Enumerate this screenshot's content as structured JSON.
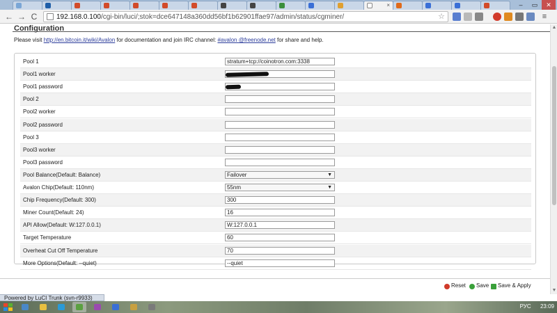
{
  "browser": {
    "tabs": [
      {
        "favicon_color": "#7aa6d6",
        "active": false
      },
      {
        "favicon_color": "#1e5ea8",
        "active": false
      },
      {
        "favicon_color": "#d24b2a",
        "active": false
      },
      {
        "favicon_color": "#d24b2a",
        "active": false
      },
      {
        "favicon_color": "#d24b2a",
        "active": false
      },
      {
        "favicon_color": "#d24b2a",
        "active": false
      },
      {
        "favicon_color": "#d24b2a",
        "active": false
      },
      {
        "favicon_color": "#444444",
        "active": false
      },
      {
        "favicon_color": "#444444",
        "active": false
      },
      {
        "favicon_color": "#3b8f3b",
        "active": false
      },
      {
        "favicon_color": "#3a6fd6",
        "active": false
      },
      {
        "favicon_color": "#e0a030",
        "active": false
      },
      {
        "favicon_color": "#ffffff",
        "active": true
      },
      {
        "favicon_color": "#e06a1a",
        "active": false
      },
      {
        "favicon_color": "#3a6fd6",
        "active": false
      },
      {
        "favicon_color": "#3a6fd6",
        "active": false
      },
      {
        "favicon_color": "#d24b2a",
        "active": false
      }
    ],
    "tab_close_glyph": "×",
    "back_glyph": "←",
    "forward_glyph": "→",
    "reload_glyph": "C",
    "url_host": "192.168.0.100",
    "url_path": "/cgi-bin/luci/;stok=dce647148a360dd56bf1b62901ffae97/admin/status/cgminer/",
    "star_glyph": "☆",
    "minimize_glyph": "–",
    "maximize_glyph": "▭",
    "close_glyph": "✕"
  },
  "page": {
    "title": "Configuration",
    "intro_before": "Please visit ",
    "intro_link1": "http://en.bitcoin.it/wiki/Avalon",
    "intro_mid": " for documentation and join IRC channel: ",
    "intro_link2": "#avalon @freenode.net",
    "intro_after": " for share and help.",
    "fields": [
      {
        "label": "Pool 1",
        "value": "stratum+tcp://coinotron.com:3338",
        "type": "text"
      },
      {
        "label": "Pool1 worker",
        "value": "",
        "type": "redacted"
      },
      {
        "label": "Pool1 password",
        "value": "",
        "type": "redacted"
      },
      {
        "label": "Pool 2",
        "value": "",
        "type": "text"
      },
      {
        "label": "Pool2 worker",
        "value": "",
        "type": "text"
      },
      {
        "label": "Pool2 password",
        "value": "",
        "type": "text"
      },
      {
        "label": "Pool 3",
        "value": "",
        "type": "text"
      },
      {
        "label": "Pool3 worker",
        "value": "",
        "type": "text"
      },
      {
        "label": "Pool3 password",
        "value": "",
        "type": "text"
      },
      {
        "label": "Pool Balance(Default: Balance)",
        "value": "Failover",
        "type": "select"
      },
      {
        "label": "Avalon Chip(Default: 110nm)",
        "value": "55nm",
        "type": "select"
      },
      {
        "label": "Chip Frequency(Default: 300)",
        "value": "300",
        "type": "text"
      },
      {
        "label": "Miner Count(Default: 24)",
        "value": "16",
        "type": "text"
      },
      {
        "label": "API Allow(Default: W:127.0.0.1)",
        "value": "W:127.0.0.1",
        "type": "text"
      },
      {
        "label": "Target Temperature",
        "value": "60",
        "type": "text"
      },
      {
        "label": "Overheat Cut Off Temperature",
        "value": "70",
        "type": "text"
      },
      {
        "label": "More Options(Default: --quiet)",
        "value": "--quiet",
        "type": "text"
      }
    ],
    "reset_label": "Reset",
    "save_label": "Save",
    "save_apply_label": "Save & Apply",
    "footer": "Powered by LuCI Trunk (svn-r9933)"
  },
  "taskbar": {
    "apps": [
      "#4a88c8",
      "#e8c040",
      "#2a9ad8",
      "#5aa040",
      "#9a4ab0",
      "#3a6fd6",
      "#c8a040",
      "#7a7a7a"
    ],
    "lang": "РУС",
    "time": "23:09"
  },
  "colors": {
    "link": "#2a3b9a",
    "reset_icon": "#d03a2a",
    "save_icon": "#3aa03a",
    "apply_icon": "#3aa03a"
  }
}
